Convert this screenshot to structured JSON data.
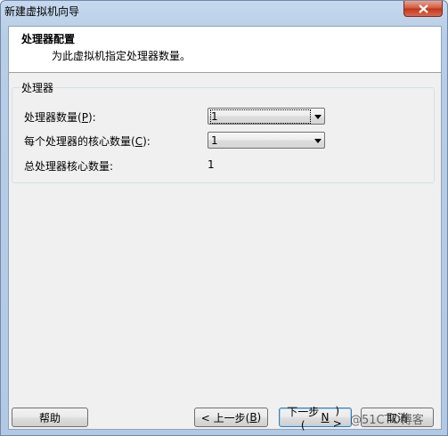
{
  "window": {
    "title": "新建虚拟机向导"
  },
  "header": {
    "title": "处理器配置",
    "subtitle": "为此虚拟机指定处理器数量。"
  },
  "group": {
    "label": "处理器",
    "processors": {
      "label": "处理器数量(P):",
      "value": "1"
    },
    "cores": {
      "label": "每个处理器的核心数量(C):",
      "value": "1"
    },
    "total": {
      "label": "总处理器核心数量:",
      "value": "1"
    }
  },
  "buttons": {
    "help": "帮助",
    "back": "< 上一步(B)",
    "next": "下一步(N) >",
    "cancel": "取消"
  },
  "watermark": "@51CTO博客"
}
